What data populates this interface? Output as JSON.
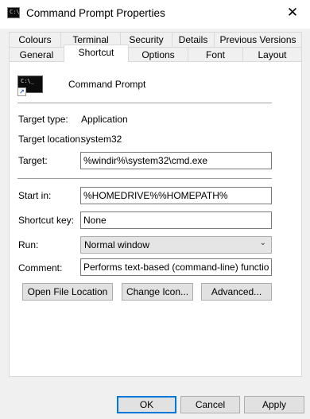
{
  "window": {
    "title": "Command Prompt Properties",
    "close_glyph": "✕"
  },
  "tabs_back": [
    "Colours",
    "Terminal",
    "Security",
    "Details",
    "Previous Versions"
  ],
  "tabs_front": [
    "General",
    "Shortcut",
    "Options",
    "Font",
    "Layout"
  ],
  "active_tab": "Shortcut",
  "shortcut": {
    "name": "Command Prompt",
    "icon_text": "C:\\_",
    "target_type_label": "Target type:",
    "target_type": "Application",
    "target_location_label": "Target location:",
    "target_location": "system32",
    "target_label": "Target:",
    "target": "%windir%\\system32\\cmd.exe",
    "start_in_label": "Start in:",
    "start_in": "%HOMEDRIVE%%HOMEPATH%",
    "shortcut_key_label": "Shortcut key:",
    "shortcut_key": "None",
    "run_label": "Run:",
    "run": "Normal window",
    "comment_label": "Comment:",
    "comment": "Performs text-based (command-line) functions.",
    "open_location_button": "Open File Location",
    "change_icon_button": "Change Icon...",
    "advanced_button": "Advanced..."
  },
  "footer": {
    "ok": "OK",
    "cancel": "Cancel",
    "apply": "Apply"
  }
}
